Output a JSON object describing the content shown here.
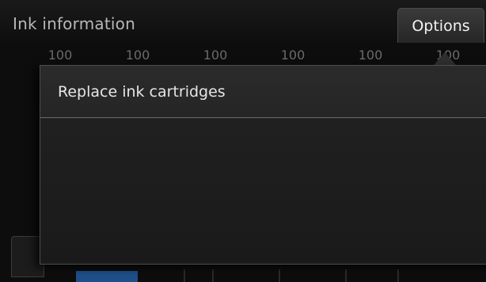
{
  "header": {
    "title": "Ink information",
    "options_label": "Options"
  },
  "ink_levels": [
    "100",
    "100",
    "100",
    "100",
    "100",
    "100"
  ],
  "options_menu": {
    "items": [
      {
        "label": "Replace ink cartridges"
      }
    ]
  },
  "colors": {
    "background": "#0d0d0d",
    "panel": "#242424",
    "accent_blue": "#1f4f88"
  }
}
